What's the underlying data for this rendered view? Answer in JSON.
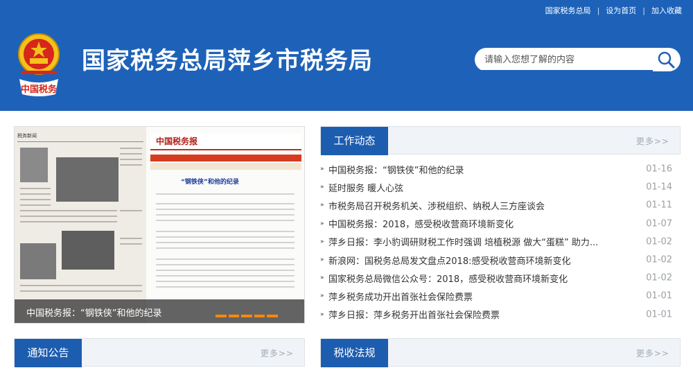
{
  "top_links": [
    "国家税务总局",
    "设为首页",
    "加入收藏"
  ],
  "site_title": "国家税务总局萍乡市税务局",
  "emblem_text": "中国税务",
  "search": {
    "placeholder": "请输入您想了解的内容"
  },
  "slide": {
    "caption": "中国税务报：“钢铁侠”和他的纪录",
    "thumbnail_headline": "“钢铁侠”和他的纪录",
    "thumbnail_logo": "中国税务报",
    "thumbnail_section": "税务新闻"
  },
  "panels": {
    "work_news": {
      "title": "工作动态",
      "more": "更多>>",
      "items": [
        {
          "title": "中国税务报：“钢铁侠”和他的纪录",
          "date": "01-16"
        },
        {
          "title": "延时服务 暖人心弦",
          "date": "01-14"
        },
        {
          "title": "市税务局召开税务机关、涉税组织、纳税人三方座谈会",
          "date": "01-11"
        },
        {
          "title": "中国税务报：2018，感受税收营商环境新变化",
          "date": "01-07"
        },
        {
          "title": "萍乡日报：李小豹调研财税工作时强调 培植税源 做大“蛋糕” 助力...",
          "date": "01-02"
        },
        {
          "title": "新浪网：国税务总局发文盘点2018:感受税收营商环境新变化",
          "date": "01-02"
        },
        {
          "title": "国家税务总局微信公众号：2018，感受税收营商环境新变化",
          "date": "01-02"
        },
        {
          "title": "萍乡税务成功开出首张社会保险费票",
          "date": "01-01"
        },
        {
          "title": "萍乡日报：萍乡税务开出首张社会保险费票",
          "date": "01-01"
        }
      ]
    },
    "notices": {
      "title": "通知公告",
      "more": "更多>>"
    },
    "tax_law": {
      "title": "税收法规",
      "more": "更多>>"
    }
  },
  "colors": {
    "header_blue": "#1d62b8",
    "tab_blue": "#1d5db0",
    "emblem_red": "#d7261b",
    "emblem_gold": "#f4c21b"
  },
  "icons": [
    "national-emblem-icon",
    "search-icon",
    "list-arrow-icon"
  ]
}
